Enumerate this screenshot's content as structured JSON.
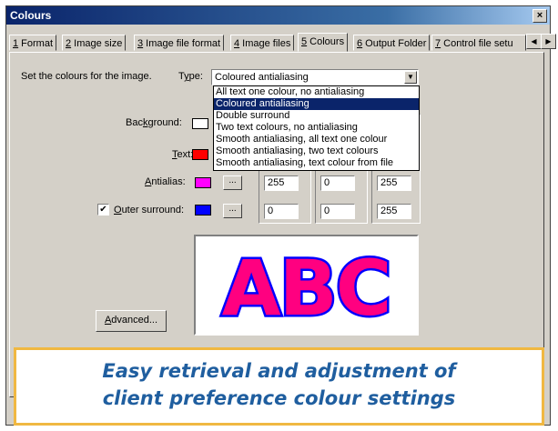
{
  "window": {
    "title": "Colours",
    "close_glyph": "×"
  },
  "tabs": [
    {
      "key": "1",
      "label": " Format"
    },
    {
      "key": "2",
      "label": " Image size"
    },
    {
      "key": "3",
      "label": " Image file format"
    },
    {
      "key": "4",
      "label": " Image files"
    },
    {
      "key": "5",
      "label": " Colours",
      "active": true
    },
    {
      "key": "6",
      "label": " Output Folder"
    },
    {
      "key": "7",
      "label": " Control file setu"
    }
  ],
  "tab_scroll": {
    "left": "◀",
    "right": "▶"
  },
  "panel": {
    "intro": "Set the colours for the image.",
    "type_label_pre": "T",
    "type_label_key": "y",
    "type_label_post": "pe:",
    "type_value": "Coloured antialiasing",
    "type_options": [
      "All text one colour, no antialiasing",
      "Coloured antialiasing",
      "Double surround",
      "Two text colours, no antialiasing",
      "Smooth antialiasing, all text one colour",
      "Smooth antialiasing, two text colours",
      "Smooth antialiasing, text colour from file"
    ],
    "type_selected_index": 1
  },
  "colours": {
    "background": {
      "label_pre": "Bac",
      "label_key": "k",
      "label_post": "ground:",
      "color": "#ffffff"
    },
    "text": {
      "label_pre": "",
      "label_key": "T",
      "label_post": "ext:",
      "color": "#ff0000"
    },
    "antialias": {
      "label_pre": "",
      "label_key": "A",
      "label_post": "ntialias:",
      "color": "#ff00ff",
      "r": "255",
      "g": "0",
      "b": "255"
    },
    "outer": {
      "label_pre": "",
      "label_key": "O",
      "label_post": "uter surround:",
      "color": "#0000ff",
      "checked": true,
      "r": "0",
      "g": "0",
      "b": "255"
    },
    "dots_label": "..."
  },
  "preview": {
    "text": "ABC",
    "fill_color": "#ff0080",
    "outline_color": "#0000ff"
  },
  "advanced_button": {
    "label_key": "A",
    "label_post": "dvanced..."
  },
  "caption": {
    "line1": "Easy retrieval and adjustment of",
    "line2": "client preference colour settings",
    "color": "#1f5e9f",
    "border": "#f0b842"
  }
}
